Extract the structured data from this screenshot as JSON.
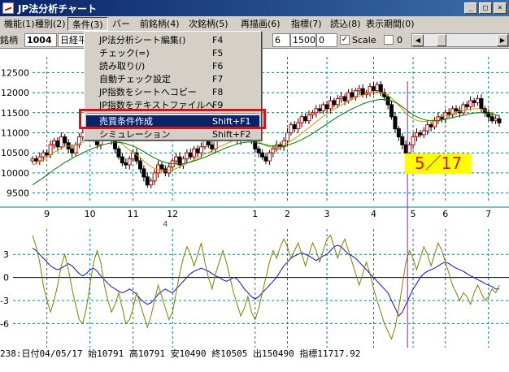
{
  "window": {
    "title": "JP法分析チャート",
    "min": "_",
    "max": "□",
    "close": "×"
  },
  "menubar": [
    {
      "label": "機能(1)"
    },
    {
      "label": "種別(2)"
    },
    {
      "label": "条件(3)",
      "active": true
    },
    {
      "label": "バー"
    },
    {
      "label": "前銘柄(4)"
    },
    {
      "label": "次銘柄(5)"
    },
    {
      "label": "再描画(6)"
    },
    {
      "label": "指標(7)"
    },
    {
      "label": "読込(8)"
    },
    {
      "label": "表示期間(0)"
    }
  ],
  "toolbar": {
    "brand_label": "銘柄",
    "code": "1004",
    "name": "日経平",
    "field1": "6",
    "field2": "1500",
    "field3": "0",
    "scale_checked": "✓",
    "scale_label": "Scale",
    "zero_label": "0"
  },
  "dropdown": {
    "items": [
      {
        "label": "JP法分析シート編集()",
        "shortcut": "F4"
      },
      {
        "label": "チェック(=)",
        "shortcut": "F5"
      },
      {
        "label": "読み取り(/)",
        "shortcut": "F6"
      },
      {
        "label": "自動チェック設定",
        "shortcut": "F7"
      },
      {
        "label": "JP指数をシートへコピー",
        "shortcut": "F8"
      },
      {
        "label": "JP指数をテキストファイルへ",
        "shortcut": "F9"
      },
      {
        "label": "売買条件作成",
        "shortcut": "Shift+F1",
        "selected": true
      },
      {
        "label": "シミュレーション",
        "shortcut": "Shift+F2"
      }
    ]
  },
  "chart_data": {
    "type": "line",
    "price_axis": {
      "ticks": [
        12500,
        12000,
        11500,
        11000,
        10500,
        10000,
        9500
      ],
      "ylim": [
        9350,
        12650
      ]
    },
    "osc_axis": {
      "ticks": [
        "3",
        "0",
        "-3",
        "-6"
      ],
      "ylim": [
        -8.5,
        6.3
      ]
    },
    "month_ticks": [
      {
        "label": "9",
        "idx": 4
      },
      {
        "label": "10",
        "idx": 16
      },
      {
        "label": "11",
        "idx": 28
      },
      {
        "label": "12",
        "idx": 39
      },
      {
        "label": "1",
        "idx": 62
      },
      {
        "label": "2",
        "idx": 71
      },
      {
        "label": "3",
        "idx": 82
      },
      {
        "label": "4",
        "idx": 95
      },
      {
        "label": "5",
        "idx": 106
      },
      {
        "label": "6",
        "idx": 115
      },
      {
        "label": "7",
        "idx": 127
      }
    ],
    "year_label": "4",
    "marker_label": "5／17",
    "series": [
      {
        "name": "close",
        "color": "#cc0000",
        "values": [
          10350,
          10300,
          10400,
          10500,
          10450,
          10700,
          10800,
          10650,
          10900,
          10750,
          10600,
          10500,
          10700,
          10900,
          11000,
          11150,
          11000,
          10850,
          10700,
          10900,
          11100,
          11000,
          10800,
          10600,
          10400,
          10250,
          10200,
          10350,
          10500,
          10300,
          10100,
          9900,
          9700,
          9800,
          10000,
          10200,
          10100,
          10000,
          10150,
          10300,
          10400,
          10200,
          10350,
          10500,
          10400,
          10600,
          10500,
          10650,
          10800,
          10700,
          10600,
          10850,
          11000,
          10900,
          10950,
          11050,
          10900,
          10800,
          11000,
          11100,
          10950,
          10800,
          10600,
          10500,
          10400,
          10300,
          10500,
          10600,
          10700,
          10650,
          10800,
          11000,
          11200,
          11100,
          11250,
          11400,
          11300,
          11450,
          11500,
          11600,
          11550,
          11700,
          11600,
          11800,
          11700,
          11850,
          11900,
          11800,
          12000,
          11900,
          12050,
          12100,
          11950,
          12000,
          12150,
          12050,
          12200,
          12000,
          11900,
          11700,
          11400,
          11100,
          10900,
          10700,
          10500,
          10700,
          10900,
          11000,
          10950,
          11050,
          11200,
          11150,
          11300,
          11400,
          11350,
          11500,
          11450,
          11600,
          11550,
          11500,
          11700,
          11650,
          11800,
          11750,
          11850,
          11600,
          11500,
          11400,
          11300,
          11350,
          11250
        ]
      },
      {
        "name": "ma",
        "color": "#cc9900",
        "values": [
          10200,
          10230,
          10270,
          10320,
          10380,
          10440,
          10510,
          10560,
          10610,
          10650,
          10670,
          10680,
          10700,
          10730,
          10770,
          10820,
          10850,
          10860,
          10850,
          10850,
          10870,
          10880,
          10870,
          10840,
          10790,
          10720,
          10640,
          10570,
          10510,
          10450,
          10380,
          10300,
          10220,
          10160,
          10110,
          10080,
          10060,
          10050,
          10060,
          10080,
          10110,
          10150,
          10190,
          10240,
          10280,
          10330,
          10370,
          10420,
          10470,
          10510,
          10550,
          10600,
          10650,
          10690,
          10730,
          10770,
          10800,
          10820,
          10840,
          10860,
          10860,
          10850,
          10820,
          10780,
          10730,
          10680,
          10650,
          10630,
          10630,
          10650,
          10690,
          10740,
          10800,
          10860,
          10920,
          10990,
          11060,
          11130,
          11200,
          11270,
          11340,
          11410,
          11470,
          11530,
          11590,
          11640,
          11690,
          11740,
          11790,
          11830,
          11870,
          11910,
          11940,
          11970,
          11990,
          12010,
          12020,
          12010,
          11980,
          11930,
          11860,
          11780,
          11690,
          11590,
          11490,
          11410,
          11350,
          11310,
          11290,
          11280,
          11290,
          11310,
          11340,
          11370,
          11400,
          11430,
          11460,
          11490,
          11510,
          11530,
          11550,
          11570,
          11590,
          11600,
          11600,
          11590,
          11560,
          11530,
          11490,
          11450,
          11410
        ]
      },
      {
        "name": "ma2",
        "color": "#007700",
        "values": [
          9700,
          9760,
          9820,
          9880,
          9950,
          10010,
          10080,
          10140,
          10200,
          10260,
          10310,
          10360,
          10410,
          10450,
          10500,
          10540,
          10580,
          10620,
          10650,
          10680,
          10710,
          10730,
          10750,
          10760,
          10760,
          10750,
          10730,
          10700,
          10670,
          10630,
          10580,
          10530,
          10470,
          10420,
          10370,
          10330,
          10290,
          10260,
          10240,
          10230,
          10220,
          10220,
          10230,
          10250,
          10270,
          10300,
          10330,
          10360,
          10390,
          10430,
          10470,
          10510,
          10550,
          10590,
          10630,
          10660,
          10690,
          10720,
          10740,
          10760,
          10770,
          10770,
          10760,
          10740,
          10720,
          10700,
          10680,
          10670,
          10660,
          10660,
          10670,
          10690,
          10720,
          10750,
          10790,
          10830,
          10880,
          10930,
          10980,
          11040,
          11100,
          11160,
          11220,
          11280,
          11340,
          11400,
          11450,
          11500,
          11550,
          11600,
          11640,
          11680,
          11720,
          11750,
          11780,
          11800,
          11820,
          11830,
          11830,
          11820,
          11800,
          11760,
          11710,
          11650,
          11580,
          11510,
          11450,
          11400,
          11360,
          11330,
          11310,
          11300,
          11300,
          11310,
          11320,
          11340,
          11360,
          11380,
          11400,
          11420,
          11440,
          11460,
          11480,
          11490,
          11500,
          11500,
          11490,
          11480,
          11460,
          11440,
          11420
        ]
      },
      {
        "name": "osc1",
        "color": "#1010cc",
        "values": [
          3.8,
          3.5,
          3.0,
          2.5,
          2.0,
          1.5,
          1.2,
          1.0,
          1.2,
          1.5,
          1.8,
          1.5,
          1.0,
          0.5,
          0.2,
          0.5,
          1.0,
          1.2,
          0.8,
          0.2,
          -0.3,
          -0.8,
          -1.2,
          -1.5,
          -1.8,
          -2.0,
          -1.8,
          -1.5,
          -1.8,
          -2.2,
          -2.8,
          -3.2,
          -3.5,
          -3.3,
          -2.8,
          -2.2,
          -1.8,
          -1.5,
          -1.8,
          -2.0,
          -1.5,
          -1.0,
          -0.5,
          0.0,
          0.5,
          0.8,
          1.0,
          1.2,
          1.0,
          0.8,
          0.5,
          0.2,
          0.0,
          -0.3,
          -0.5,
          -0.3,
          0.0,
          -0.2,
          -0.8,
          -1.5,
          -2.0,
          -2.5,
          -2.8,
          -2.5,
          -2.0,
          -1.5,
          -1.0,
          -0.5,
          0.0,
          0.8,
          1.5,
          2.0,
          2.5,
          2.8,
          3.0,
          3.2,
          3.0,
          2.8,
          2.5,
          2.2,
          2.5,
          2.8,
          3.0,
          3.5,
          4.0,
          4.2,
          4.0,
          3.5,
          3.0,
          2.8,
          2.5,
          2.0,
          1.5,
          1.0,
          0.5,
          0.0,
          -0.5,
          -1.0,
          -1.5,
          -2.0,
          -3.0,
          -4.0,
          -5.0,
          -4.5,
          -3.5,
          -2.5,
          -1.5,
          -0.8,
          0.0,
          0.5,
          0.8,
          1.0,
          1.2,
          1.5,
          1.8,
          2.0,
          1.8,
          1.5,
          1.2,
          1.0,
          0.8,
          0.5,
          0.2,
          0.0,
          -0.3,
          -0.5,
          -0.8,
          -1.0,
          -1.2,
          -1.5,
          -1.5
        ]
      },
      {
        "name": "osc2",
        "color": "#808000",
        "values": [
          5.5,
          4.0,
          2.0,
          -1.0,
          -3.0,
          -4.5,
          -3.0,
          -1.0,
          1.5,
          3.0,
          1.0,
          -1.5,
          -3.5,
          -5.5,
          -6.0,
          -4.0,
          -1.0,
          2.0,
          3.5,
          2.0,
          -1.0,
          -3.0,
          -4.5,
          -3.5,
          -2.0,
          -4.0,
          -6.0,
          -5.5,
          -4.0,
          -2.0,
          -3.5,
          -5.0,
          -6.5,
          -5.0,
          -3.0,
          -1.0,
          -2.5,
          -4.0,
          -5.5,
          -4.5,
          -2.0,
          0.5,
          2.5,
          4.0,
          3.0,
          1.5,
          3.0,
          4.5,
          2.0,
          0.0,
          -1.5,
          0.5,
          2.0,
          3.5,
          2.0,
          0.0,
          -2.0,
          -3.5,
          -5.0,
          -4.0,
          -2.5,
          -4.5,
          -5.5,
          -4.0,
          -2.0,
          0.0,
          2.0,
          3.5,
          2.5,
          4.0,
          5.0,
          4.0,
          2.5,
          3.5,
          4.5,
          3.0,
          1.5,
          3.0,
          4.5,
          3.5,
          2.0,
          3.5,
          5.0,
          5.5,
          4.0,
          2.5,
          4.0,
          5.0,
          3.5,
          2.0,
          0.5,
          -1.0,
          0.5,
          2.0,
          0.5,
          -1.5,
          -3.0,
          -4.5,
          -6.0,
          -7.0,
          -8.0,
          -6.5,
          -4.0,
          -1.0,
          2.0,
          3.5,
          2.5,
          1.0,
          2.5,
          4.0,
          3.0,
          1.5,
          3.0,
          4.5,
          3.5,
          2.0,
          0.5,
          -1.0,
          -2.0,
          -3.0,
          -2.0,
          -2.5,
          -3.5,
          -2.0,
          -1.0,
          -2.0,
          -3.0,
          -2.5,
          -1.5,
          -2.0,
          -1.0
        ]
      }
    ]
  },
  "status": "238:日付04/05/17 始10791 高10791 安10490 終10505 出150490 指標11717.92",
  "colors": {
    "grid": "#008080",
    "marker": "#cc00cc",
    "up_candle": "#cc0000",
    "down_candle": "#000000",
    "redbox": "#e01010",
    "highlight": "#0a246a"
  }
}
